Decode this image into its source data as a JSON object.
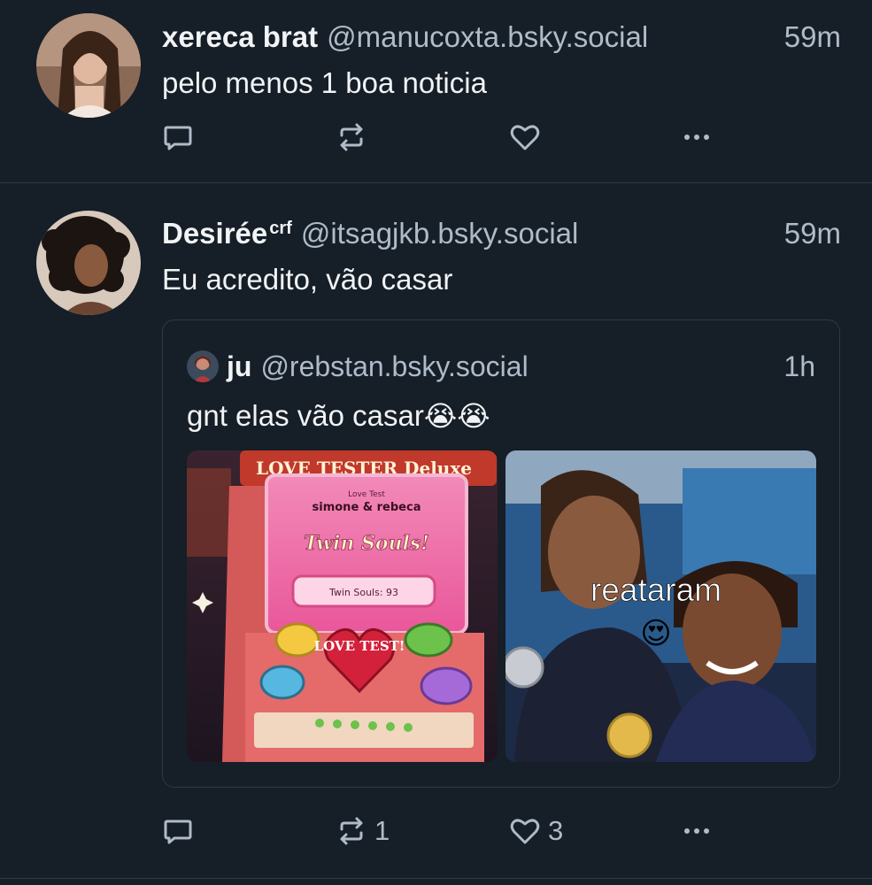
{
  "posts": [
    {
      "display_name": "xereca brat",
      "handle": "@manucoxta.bsky.social",
      "time": "59m",
      "text": "pelo menos 1 boa noticia",
      "reply_count": "",
      "repost_count": "",
      "like_count": ""
    },
    {
      "display_name": "Desirée",
      "name_suffix": "crf",
      "handle": "@itsagjkb.bsky.social",
      "time": "59m",
      "text": "Eu acredito, vão casar",
      "reply_count": "",
      "repost_count": "1",
      "like_count": "3",
      "quote": {
        "display_name": "ju",
        "handle": "@rebstan.bsky.social",
        "time": "1h",
        "text": "gnt elas vão casar",
        "emojis": "😭😭",
        "images": [
          {
            "name": "love-tester-image",
            "title_text": "LOVE TESTER Deluxe",
            "subtitle": "Love Test",
            "names": "simone & rebeca",
            "result_script": "Twin Souls!",
            "result_bar": "Twin Souls: 93",
            "button_text": "LOVE TEST!"
          },
          {
            "name": "gymnasts-photo",
            "caption": "reataram",
            "caption_emoji": "😍"
          }
        ]
      }
    }
  ],
  "icons": {
    "reply": "speech-bubble-icon",
    "repost": "repost-arrows-icon",
    "like": "heart-icon",
    "more": "more-dots-icon"
  },
  "colors": {
    "background": "#161e27",
    "text": "#f1f3f5",
    "muted": "#aebbc9",
    "border": "#2e3a47"
  }
}
